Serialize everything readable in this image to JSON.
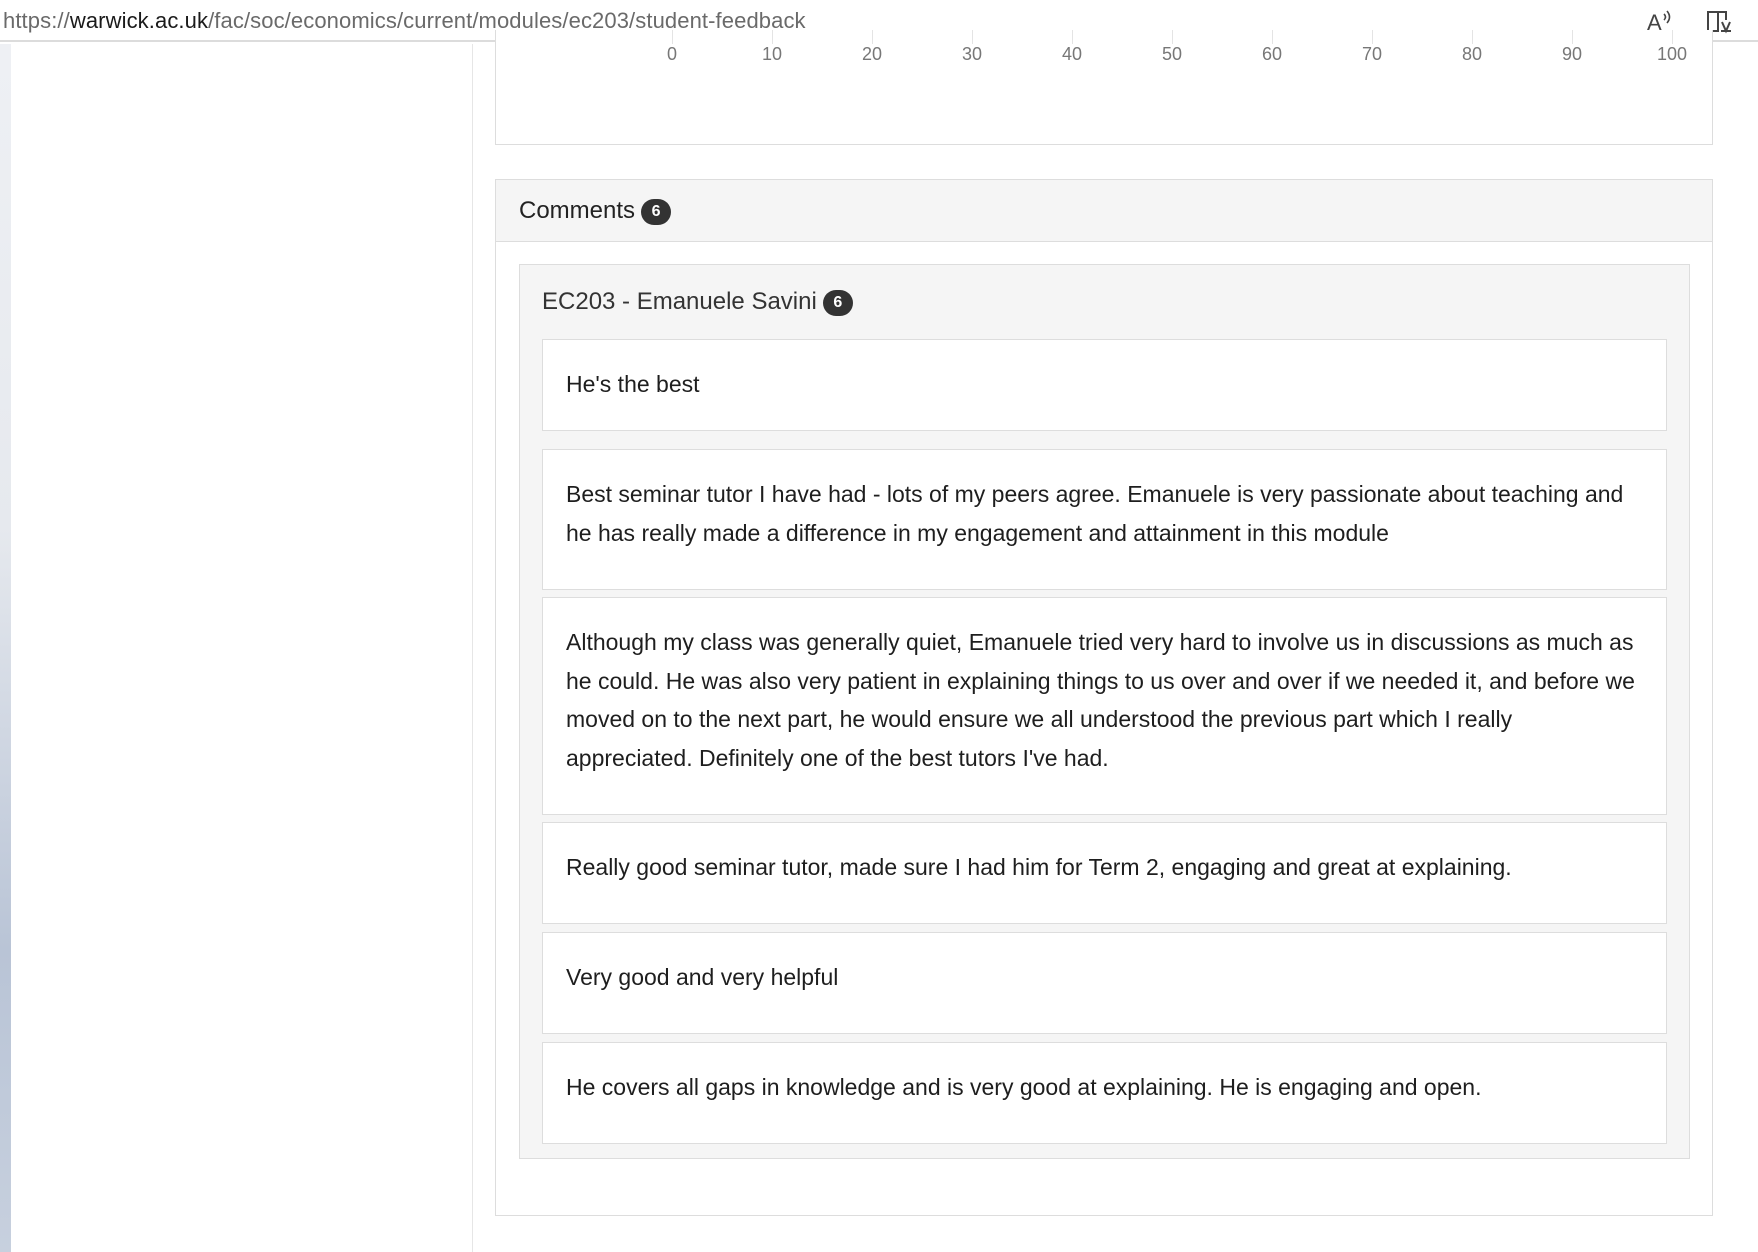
{
  "browser": {
    "url_prefix": "https://",
    "url_domain": "warwick.ac.uk",
    "url_path": "/fac/soc/economics/current/modules/ec203/student-feedback",
    "read_aloud_icon": "read-aloud-icon",
    "reader_view_icon": "reader-view-icon"
  },
  "chart": {
    "x_ticks": [
      "0",
      "10",
      "20",
      "30",
      "40",
      "50",
      "60",
      "70",
      "80",
      "90",
      "100"
    ]
  },
  "comments": {
    "title": "Comments",
    "count": "6",
    "group": {
      "title": "EC203 - Emanuele Savini",
      "count": "6",
      "items": [
        "He's the best",
        "Best seminar tutor I have had - lots of my peers agree. Emanuele is very passionate about teaching and he has really made a difference in my engagement and attainment in this module",
        "Although my class was generally quiet, Emanuele tried very hard to involve us in discussions as much as he could. He was also very patient in explaining things to us over and over if we needed it, and before we moved on to the next part, he would ensure we all understood the previous part which I really appreciated. Definitely one of the best tutors I've had.",
        "Really good seminar tutor, made sure I had him for Term 2, engaging and great at explaining.",
        "Very good and very helpful",
        "He covers all gaps in knowledge and is very good at explaining. He is engaging and open."
      ]
    }
  }
}
